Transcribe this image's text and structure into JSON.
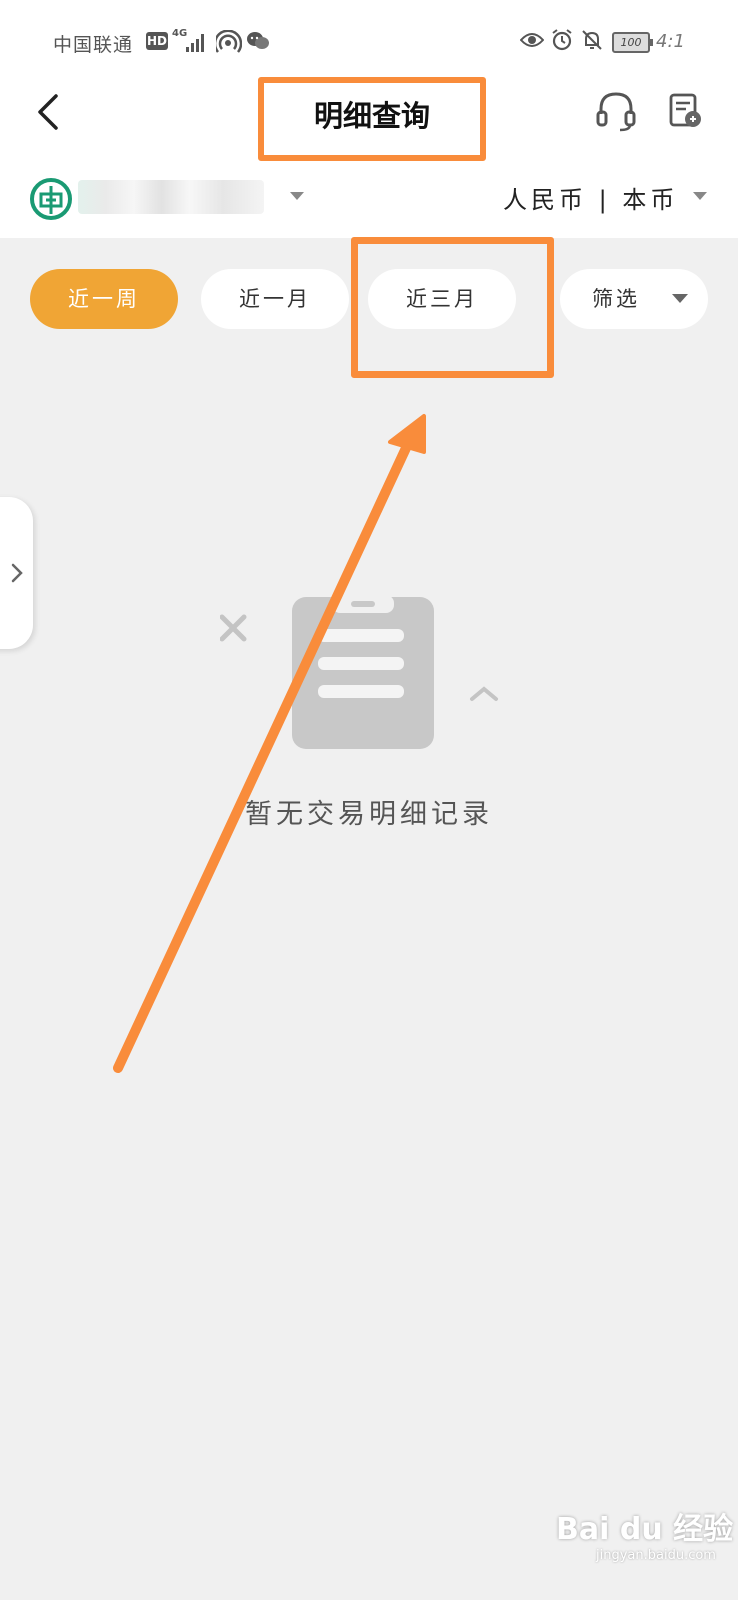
{
  "status_bar": {
    "carrier": "中国联通",
    "hd_badge": "HD",
    "network": "4G",
    "battery": "100",
    "time": "4:1"
  },
  "header": {
    "title": "明细查询",
    "icons": [
      "back-icon",
      "headset-icon",
      "export-icon"
    ]
  },
  "account": {
    "currency": "人民币 | 本币"
  },
  "filters": {
    "tabs": [
      {
        "label": "近一周",
        "active": true
      },
      {
        "label": "近一月",
        "active": false
      },
      {
        "label": "近三月",
        "active": false
      }
    ],
    "filter_label": "筛选"
  },
  "empty_state": {
    "message": "暂无交易明细记录"
  },
  "watermark": {
    "brand": "Bai du 经验",
    "url": "jingyan.baidu.com"
  },
  "colors": {
    "accent": "#f0a535",
    "annotation": "#f98c3b",
    "bank_green": "#1a9a73",
    "background": "#f0f0f0"
  }
}
